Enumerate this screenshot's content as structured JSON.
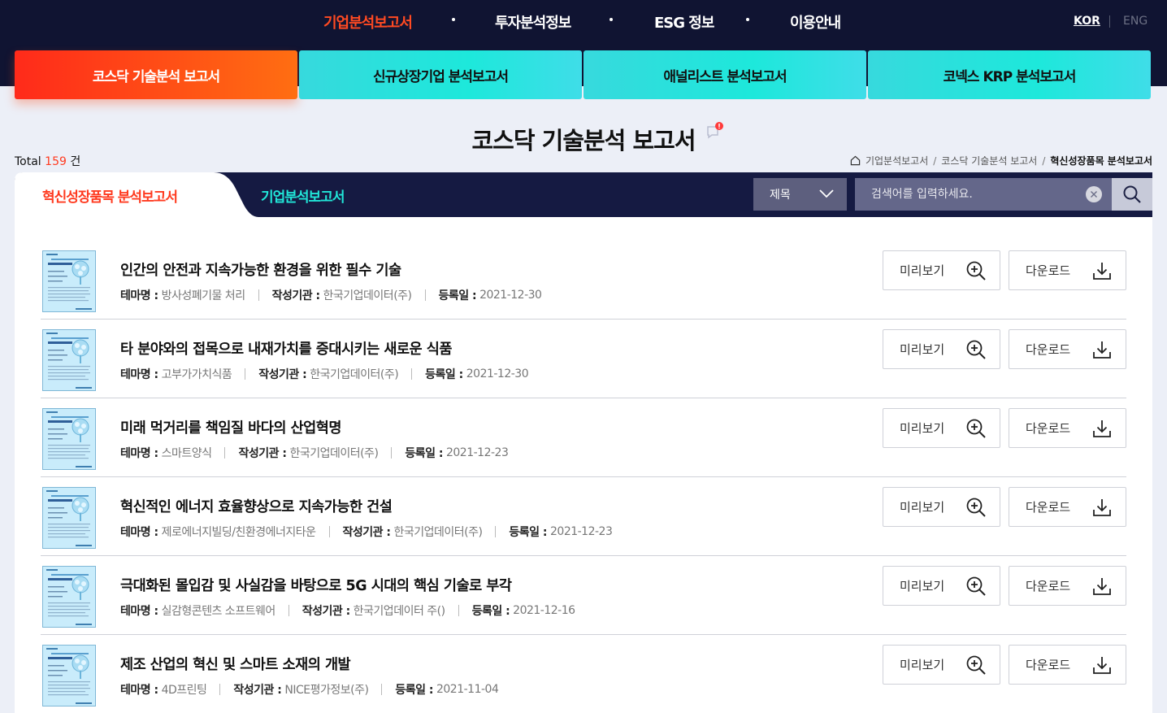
{
  "top_nav": {
    "items": [
      "기업분석보고서",
      "투자분석정보",
      "ESG 정보",
      "이용안내"
    ],
    "lang_kor": "KOR",
    "lang_eng": "ENG"
  },
  "categories": [
    "코스닥 기술분석 보고서",
    "신규상장기업 분석보고서",
    "애널리스트 분석보고서",
    "코넥스 KRP 분석보고서"
  ],
  "page": {
    "title": "코스닥 기술분석 보고서",
    "total_label": "Total",
    "total_count": "159",
    "total_unit": "건"
  },
  "breadcrumb": [
    "기업분석보고서",
    "코스닥 기술분석 보고서",
    "혁신성장품목 분석보고서"
  ],
  "tabs": [
    "혁신성장품목 분석보고서",
    "기업분석보고서"
  ],
  "search": {
    "field_selected": "제목",
    "placeholder": "검색어를 입력하세요."
  },
  "labels": {
    "theme": "테마명 :",
    "org": "작성기관 :",
    "date": "등록일 :",
    "preview": "미리보기",
    "download": "다운로드"
  },
  "reports": [
    {
      "title": "인간의 안전과 지속가능한 환경을 위한 필수 기술",
      "theme": "방사성폐기물 처리",
      "org": "한국기업데이터(주)",
      "date": "2021-12-30"
    },
    {
      "title": "타 분야와의 접목으로 내재가치를 증대시키는 새로운 식품",
      "theme": "고부가가치식품",
      "org": "한국기업데이터(주)",
      "date": "2021-12-30"
    },
    {
      "title": "미래 먹거리를 책임질 바다의 산업혁명",
      "theme": "스마트양식",
      "org": "한국기업데이터(주)",
      "date": "2021-12-23"
    },
    {
      "title": "혁신적인 에너지 효율향상으로 지속가능한 건설",
      "theme": "제로에너지빌딩/친환경에너지타운",
      "org": "한국기업데이터(주)",
      "date": "2021-12-23"
    },
    {
      "title": "극대화된 몰입감 및 사실감을 바탕으로 5G 시대의 핵심 기술로 부각",
      "theme": "실감형콘텐츠 소프트웨어",
      "org": "한국기업데이터 주()",
      "date": "2021-12-16"
    },
    {
      "title": "제조 산업의 혁신 및 스마트 소재의 개발",
      "theme": "4D프린팅",
      "org": "NICE평가정보(주)",
      "date": "2021-11-04"
    }
  ],
  "colors": {
    "navy": "#101432",
    "accent_orange": "#ff3a1f",
    "accent_cyan": "#21e6d8"
  }
}
